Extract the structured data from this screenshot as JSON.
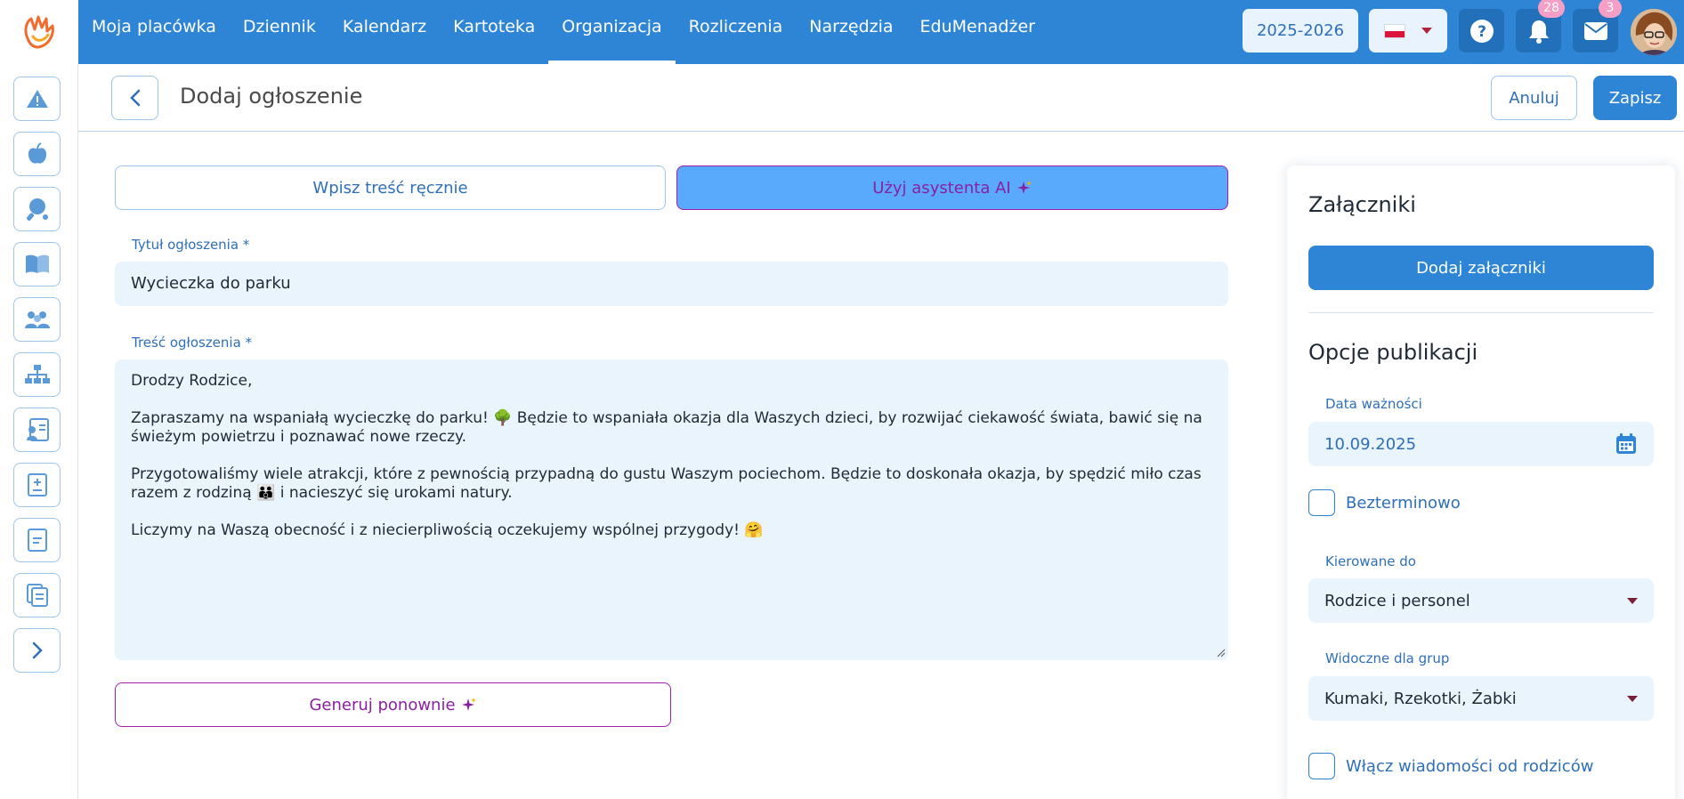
{
  "topbar": {
    "nav": [
      {
        "label": "Moja placówka"
      },
      {
        "label": "Dziennik"
      },
      {
        "label": "Kalendarz"
      },
      {
        "label": "Kartoteka"
      },
      {
        "label": "Organizacja",
        "active": true
      },
      {
        "label": "Rozliczenia"
      },
      {
        "label": "Narzędzia"
      },
      {
        "label": "EduMenadżer"
      }
    ],
    "school_year": "2025-2026",
    "language": "pl",
    "notifications_count": "28",
    "messages_count": "3",
    "colors": {
      "bar": "#2e85d6",
      "badge": "#f59fc6"
    }
  },
  "sidebar": {
    "items": [
      {
        "icon": "warning-icon"
      },
      {
        "icon": "apple-icon"
      },
      {
        "icon": "ping-pong-icon"
      },
      {
        "icon": "book-icon"
      },
      {
        "icon": "group-icon"
      },
      {
        "icon": "org-chart-icon"
      },
      {
        "icon": "user-list-icon"
      },
      {
        "icon": "document-add-icon"
      },
      {
        "icon": "document-icon"
      },
      {
        "icon": "documents-icon"
      },
      {
        "icon": "chevron-right-icon"
      }
    ]
  },
  "header": {
    "title": "Dodaj ogłoszenie",
    "cancel_label": "Anuluj",
    "save_label": "Zapisz"
  },
  "form": {
    "mode_manual_label": "Wpisz treść ręcznie",
    "mode_ai_label": "Użyj asystenta AI",
    "title_label": "Tytuł ogłoszenia *",
    "title_value": "Wycieczka do parku",
    "content_label": "Treść ogłoszenia *",
    "content": {
      "greeting": "Drodzy Rodzice,",
      "p1": "Zapraszamy na wspaniałą wycieczkę do parku! 🌳 Będzie to wspaniała okazja dla Waszych dzieci, by rozwijać ciekawość świata, bawić się na świeżym powietrzu i poznawać nowe rzeczy.",
      "p2": "Przygotowaliśmy wiele atrakcji, które z pewnością przypadną do gustu Waszym pociechom. Będzie to doskonała okazja, by spędzić miło czas razem z rodziną 👪 i nacieszyć się urokami natury.",
      "p3": "Liczymy na Waszą obecność i z niecierpliwością oczekujemy wspólnej przygody! 🤗"
    },
    "regenerate_label": "Generuj ponownie",
    "colors": {
      "ai_accent": "#a020a8",
      "ai_fill": "#59aafc",
      "field_bg": "#eaf4fd"
    }
  },
  "panel": {
    "attachments_title": "Załączniki",
    "add_attachments_label": "Dodaj załączniki",
    "publish_title": "Opcje publikacji",
    "expiry_label": "Data ważności",
    "expiry_value": "10.09.2025",
    "indefinite_label": "Bezterminowo",
    "audience_label": "Kierowane do",
    "audience_value": "Rodzice i personel",
    "groups_label": "Widoczne dla grup",
    "groups_value": "Kumaki, Rzekotki, Żabki",
    "parent_messages_label": "Włącz wiadomości od rodziców"
  }
}
